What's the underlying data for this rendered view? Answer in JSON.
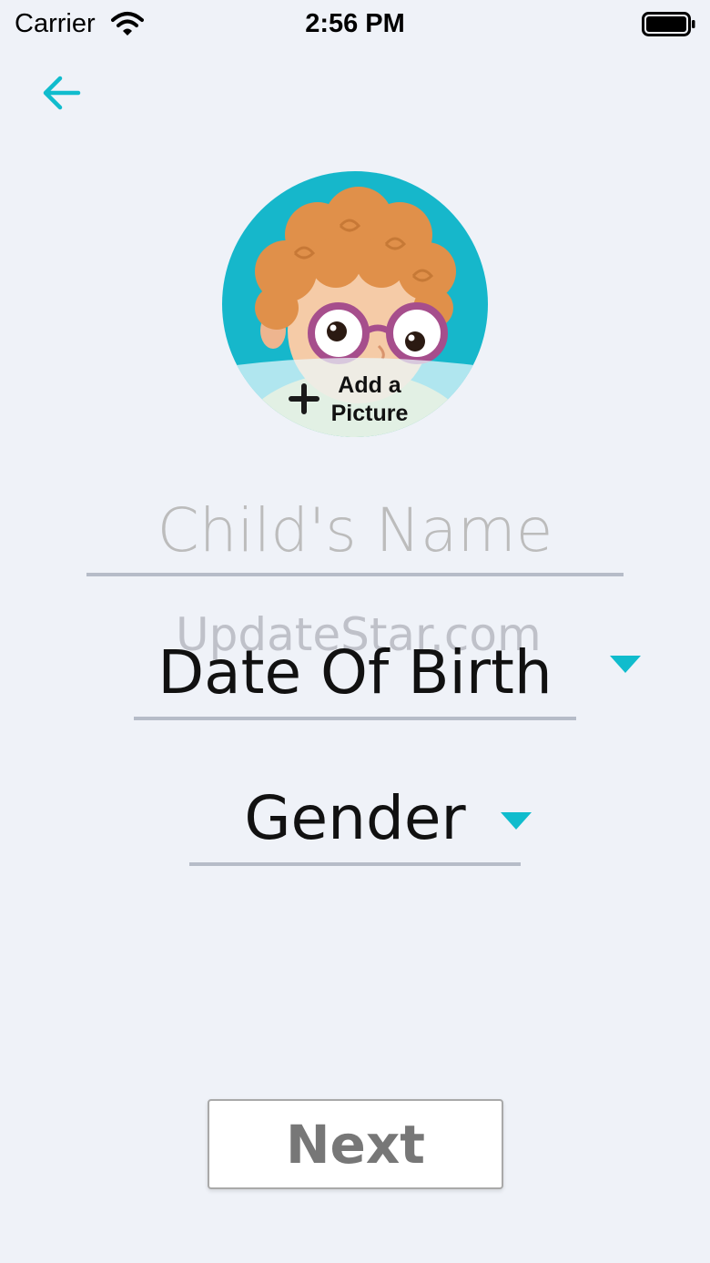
{
  "status_bar": {
    "carrier": "Carrier",
    "time": "2:56 PM"
  },
  "colors": {
    "accent": "#10bccd",
    "background": "#eff2f8",
    "underline": "#b6bcc8"
  },
  "header": {
    "back_icon": "arrow-left-icon"
  },
  "avatar": {
    "add_picture_label": "Add a\nPicture",
    "plus_icon": "plus-icon"
  },
  "form": {
    "name_placeholder": "Child's Name",
    "dob_label": "Date Of Birth",
    "gender_label": "Gender",
    "caret_icon": "caret-down-icon"
  },
  "watermark": "UpdateStar.com",
  "footer": {
    "next_label": "Next"
  }
}
